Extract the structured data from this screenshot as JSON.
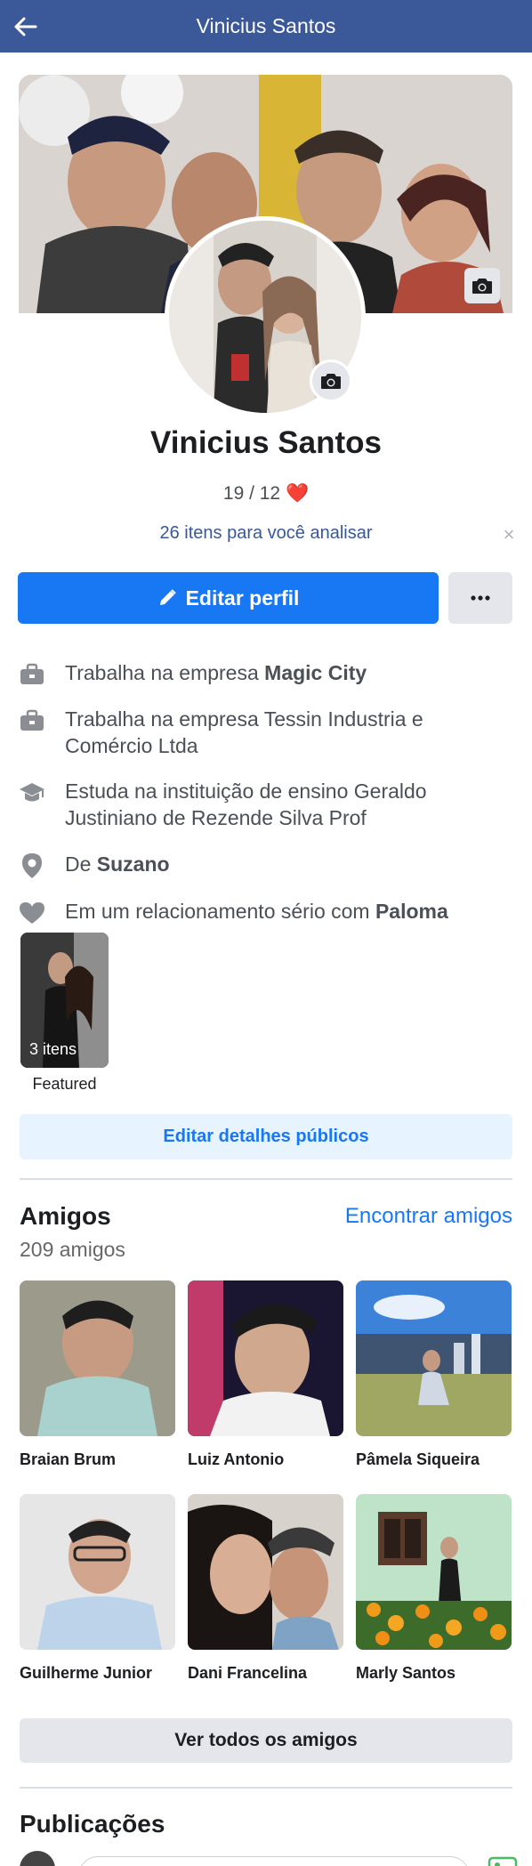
{
  "header": {
    "title": "Vinicius Santos"
  },
  "profile": {
    "name": "Vinicius Santos",
    "bio": "19 / 12 ❤️",
    "review_link": "26 itens para você analisar",
    "close": "×",
    "edit_button": "Editar perfil",
    "more_button": "···"
  },
  "details": [
    {
      "icon": "briefcase-icon",
      "prefix": "Trabalha na empresa ",
      "bold": "Magic City",
      "suffix": ""
    },
    {
      "icon": "briefcase-icon",
      "prefix": "Trabalha na empresa Tessin Industria e Comércio Ltda",
      "bold": "",
      "suffix": ""
    },
    {
      "icon": "graduation-cap-icon",
      "prefix": "Estuda na instituição de ensino Geraldo Justiniano de Rezende Silva Prof",
      "bold": "",
      "suffix": ""
    },
    {
      "icon": "location-pin-icon",
      "prefix": "De ",
      "bold": "Suzano",
      "suffix": ""
    },
    {
      "icon": "heart-icon",
      "prefix": "Em um relacionamento sério com ",
      "bold": "Paloma",
      "suffix": ""
    }
  ],
  "featured": {
    "count_label": "3 itens",
    "label": "Featured"
  },
  "edit_public_details": "Editar detalhes públicos",
  "friends": {
    "title": "Amigos",
    "find": "Encontrar amigos",
    "count": "209 amigos",
    "list": [
      {
        "name": "Braian Brum"
      },
      {
        "name": "Luiz Antonio"
      },
      {
        "name": "Pâmela Siqueira"
      },
      {
        "name": "Guilherme Junior"
      },
      {
        "name": "Dani Francelina"
      },
      {
        "name": "Marly Santos"
      }
    ],
    "see_all": "Ver todos os amigos"
  },
  "posts": {
    "title": "Publicações"
  },
  "colors": {
    "topbar": "#3b5998",
    "primary": "#1877f2",
    "link": "#385898"
  }
}
